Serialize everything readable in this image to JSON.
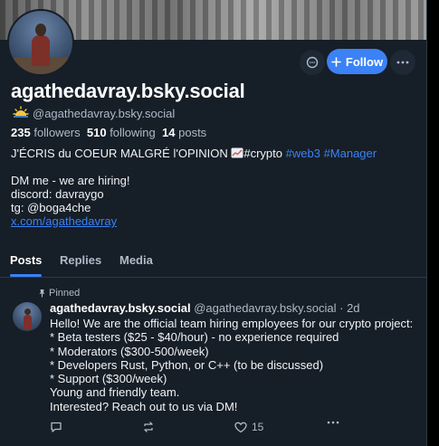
{
  "profile": {
    "display_name": "agathedavray.bsky.social",
    "handle": "@agathedavray.bsky.social",
    "followers_count": "235",
    "followers_label": "followers",
    "following_count": "510",
    "following_label": "following",
    "posts_count": "14",
    "posts_label": "posts",
    "follow_label": "Follow",
    "bio": {
      "line1_text": "J'ÉCRIS du COEUR MALGRÉ l'OPINION",
      "line1_tag_crypto": "#crypto",
      "line1_tag_web3": "#web3",
      "line1_tag_manager": "#Manager",
      "line2": "DM me - we are hiring!",
      "line3": "discord: davraygo",
      "line4": "tg: @boga4che",
      "link": "x.com/agathedavray"
    }
  },
  "tabs": [
    {
      "label": "Posts",
      "active": true
    },
    {
      "label": "Replies",
      "active": false
    },
    {
      "label": "Media",
      "active": false
    }
  ],
  "post": {
    "pinned_label": "Pinned",
    "author_name": "agathedavray.bsky.social",
    "author_handle": "@agathedavray.bsky.social",
    "separator": "·",
    "time": "2d",
    "lines": [
      "Hello!  We are the official team hiring employees for our crypto project:",
      "* Beta testers ($25 - $40/hour) - no experience required",
      "* Moderators  ($300-500/week)",
      "* Developers Rust, Python, or C++ (to be discussed)",
      "* Support ($300/week)",
      "Young and friendly team.",
      "Interested? Reach out to us via DM!"
    ],
    "like_count": "15"
  },
  "colors": {
    "accent": "#3b82f6",
    "background": "#161e27",
    "muted": "#aebbc9"
  }
}
